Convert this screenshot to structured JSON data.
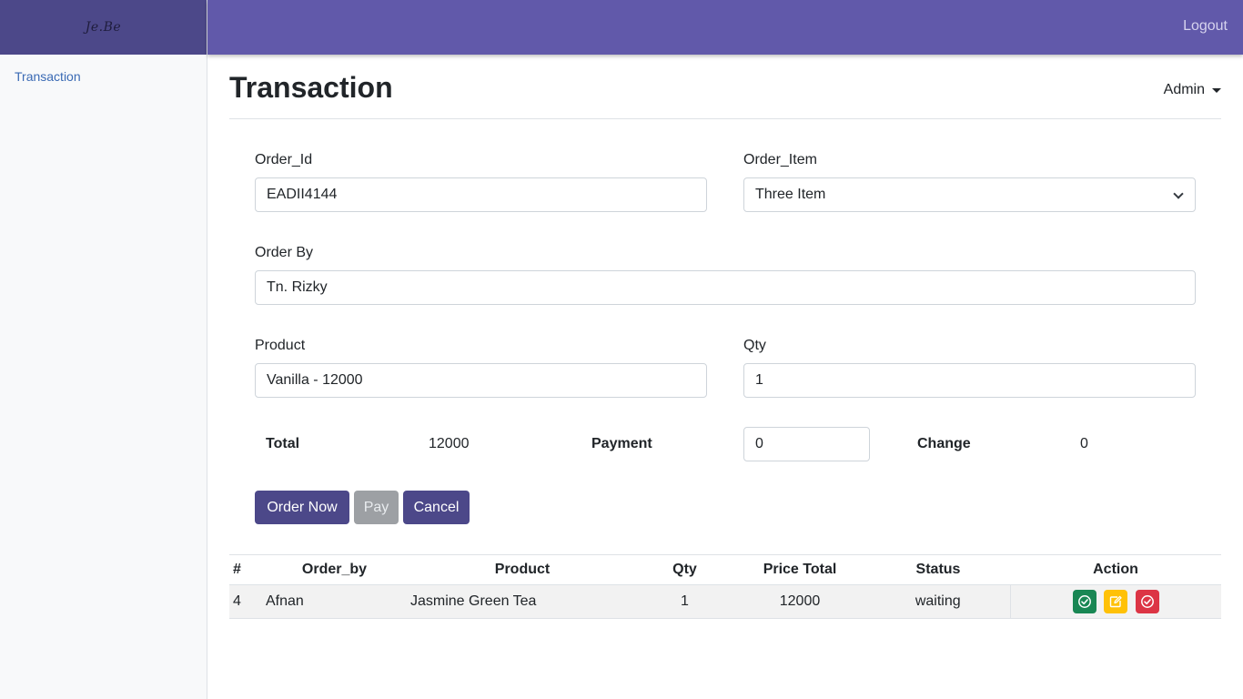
{
  "brand": {
    "logo_text": "Je.Be"
  },
  "sidebar": {
    "items": [
      {
        "label": "Transaction"
      }
    ]
  },
  "topbar": {
    "logout_label": "Logout"
  },
  "page": {
    "title": "Transaction",
    "user_menu": "Admin"
  },
  "form": {
    "order_id": {
      "label": "Order_Id",
      "value": "EADII4144"
    },
    "order_item": {
      "label": "Order_Item",
      "selected": "Three Item"
    },
    "order_by": {
      "label": "Order By",
      "value": "Tn. Rizky"
    },
    "product": {
      "label": "Product",
      "value": "Vanilla - 12000"
    },
    "qty": {
      "label": "Qty",
      "value": "1"
    }
  },
  "summary": {
    "total_label": "Total",
    "total_value": "12000",
    "payment_label": "Payment",
    "payment_value": "0",
    "change_label": "Change",
    "change_value": "0"
  },
  "buttons": {
    "order_now": "Order Now",
    "pay": "Pay",
    "cancel": "Cancel"
  },
  "table": {
    "headers": [
      "#",
      "Order_by",
      "Product",
      "Qty",
      "Price Total",
      "Status",
      "Action"
    ],
    "rows": [
      {
        "no": "4",
        "order_by": "Afnan",
        "product": "Jasmine Green Tea",
        "qty": "1",
        "price_total": "12000",
        "status": "waiting"
      }
    ]
  },
  "icons": {
    "approve": "check-circle-icon",
    "edit": "edit-icon",
    "reject": "check-circle-icon"
  },
  "colors": {
    "navbar": "#6159aa",
    "brand_bg": "#4c4889",
    "primary_button": "#4c4889",
    "link": "#3a6ab4",
    "success": "#198754",
    "warning": "#ffc107",
    "danger": "#dc3545"
  }
}
